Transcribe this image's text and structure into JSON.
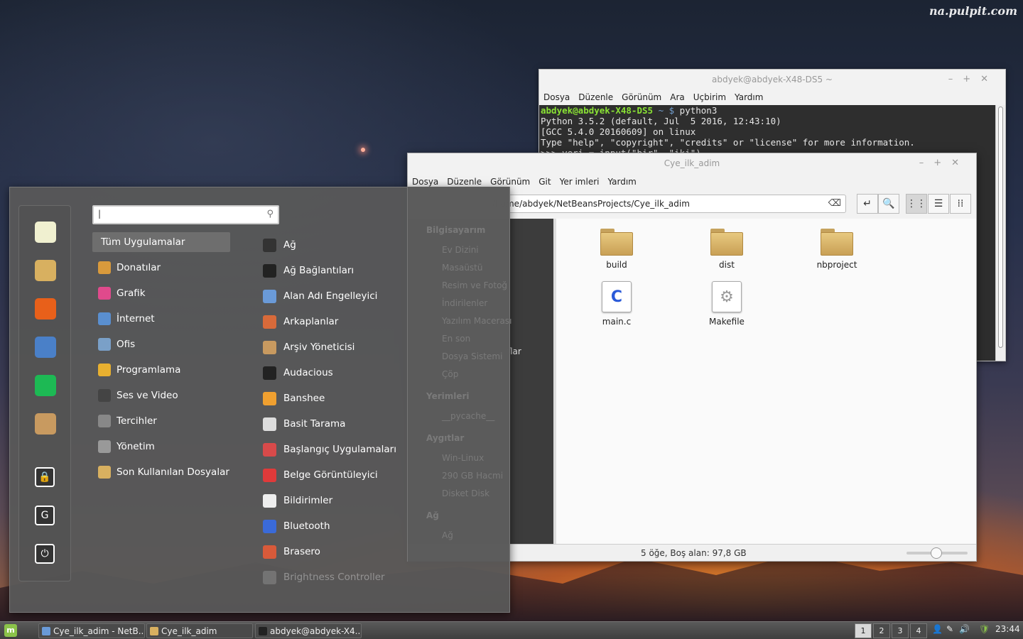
{
  "watermark": "na.pulpit.com",
  "terminal": {
    "title": "abdyek@abdyek-X48-DS5 ~",
    "menu": [
      "Dosya",
      "Düzenle",
      "Görünüm",
      "Ara",
      "Uçbirim",
      "Yardım"
    ],
    "prompt_user": "abdyek@abdyek-X48-DS5",
    "prompt_path": " ~ $",
    "command": " python3",
    "lines": [
      "Python 3.5.2 (default, Jul  5 2016, 12:43:10)",
      "[GCC 5.4.0 20160609] on linux",
      "Type \"help\", \"copyright\", \"credits\" or \"license\" for more information.",
      ">>> veri = input(\"bir\", \"iki\")"
    ]
  },
  "file_manager": {
    "title": "Cye_ilk_adim",
    "menu": [
      "Dosya",
      "Düzenle",
      "Görünüm",
      "Git",
      "Yer imleri",
      "Yardım"
    ],
    "path": "/home/abdyek/NetBeansProjects/Cye_ilk_adim",
    "partial_side_text": "flar",
    "files": [
      {
        "name": "build",
        "type": "folder"
      },
      {
        "name": "dist",
        "type": "folder"
      },
      {
        "name": "nbproject",
        "type": "folder"
      },
      {
        "name": "main.c",
        "type": "c-source"
      },
      {
        "name": "Makefile",
        "type": "makefile"
      }
    ],
    "status": "5 öğe, Boş alan: 97,8 GB",
    "zoom_level": 0.45
  },
  "sidebar_ghost": {
    "sections": [
      {
        "title": "Bilgisayarım",
        "items": [
          "Ev Dizini",
          "Masaüstü",
          "Resim ve Fotoğ",
          "İndirilenler",
          "Yazılım Macerası",
          "En son",
          "Dosya Sistemi",
          "Çöp"
        ]
      },
      {
        "title": "Yerimleri",
        "items": [
          "__pycache__"
        ]
      },
      {
        "title": "Aygıtlar",
        "items": [
          "Win-Linux",
          "290 GB Hacmi",
          "Disket Disk"
        ]
      },
      {
        "title": "Ağ",
        "items": [
          "Ağ"
        ]
      }
    ]
  },
  "start_menu": {
    "search_value": "",
    "categories": [
      {
        "label": "Tüm Uygulamalar",
        "icon": "all-apps-icon",
        "color": "#6e6e6e"
      },
      {
        "label": "Donatılar",
        "icon": "accessories-icon",
        "color": "#d99a3c"
      },
      {
        "label": "Grafik",
        "icon": "graphics-icon",
        "color": "#e04a8c"
      },
      {
        "label": "İnternet",
        "icon": "internet-icon",
        "color": "#5a8fd0"
      },
      {
        "label": "Ofis",
        "icon": "office-icon",
        "color": "#7aa0c8"
      },
      {
        "label": "Programlama",
        "icon": "programming-icon",
        "color": "#e8b030"
      },
      {
        "label": "Ses ve Video",
        "icon": "sound-video-icon",
        "color": "#444444"
      },
      {
        "label": "Tercihler",
        "icon": "preferences-icon",
        "color": "#888888"
      },
      {
        "label": "Yönetim",
        "icon": "administration-icon",
        "color": "#999999"
      },
      {
        "label": "Son Kullanılan Dosyalar",
        "icon": "recent-files-icon",
        "color": "#d8b060"
      }
    ],
    "apps": [
      {
        "label": "Ağ",
        "icon": "network-icon",
        "color": "#333333"
      },
      {
        "label": "Ağ Bağlantıları",
        "icon": "network-connections-icon",
        "color": "#222222"
      },
      {
        "label": "Alan Adı Engelleyici",
        "icon": "domain-blocker-icon",
        "color": "#6a9ad8"
      },
      {
        "label": "Arkaplanlar",
        "icon": "backgrounds-icon",
        "color": "#d86a3a"
      },
      {
        "label": "Arşiv Yöneticisi",
        "icon": "archive-manager-icon",
        "color": "#c89a60"
      },
      {
        "label": "Audacious",
        "icon": "audacious-icon",
        "color": "#222222"
      },
      {
        "label": "Banshee",
        "icon": "banshee-icon",
        "color": "#f0a030"
      },
      {
        "label": "Basit Tarama",
        "icon": "simple-scan-icon",
        "color": "#dddddd"
      },
      {
        "label": "Başlangıç Uygulamaları",
        "icon": "startup-apps-icon",
        "color": "#d84a4a"
      },
      {
        "label": "Belge Görüntüleyici",
        "icon": "document-viewer-icon",
        "color": "#e03a3a"
      },
      {
        "label": "Bildirimler",
        "icon": "notifications-icon",
        "color": "#eeeeee"
      },
      {
        "label": "Bluetooth",
        "icon": "bluetooth-icon",
        "color": "#3a6ad8"
      },
      {
        "label": "Brasero",
        "icon": "brasero-icon",
        "color": "#d85a3a"
      },
      {
        "label": "Brightness Controller",
        "icon": "brightness-icon",
        "color": "#aaaaaa"
      }
    ],
    "favorites": [
      {
        "icon": "settings-icon",
        "color": "#f0f0d0"
      },
      {
        "icon": "files-icon",
        "color": "#d8b060"
      },
      {
        "icon": "firefox-icon",
        "color": "#e8601a"
      },
      {
        "icon": "pidgin-icon",
        "color": "#4a80c8"
      },
      {
        "icon": "spotify-icon",
        "color": "#1db954"
      },
      {
        "icon": "package-icon",
        "color": "#c89a60"
      }
    ],
    "system": [
      {
        "icon": "lock-icon",
        "glyph": "🔒"
      },
      {
        "icon": "logout-icon",
        "glyph": "G"
      },
      {
        "icon": "power-icon",
        "glyph": "⏻"
      }
    ]
  },
  "taskbar": {
    "tasks": [
      {
        "label": "Cye_ilk_adim - NetB...",
        "icon": "netbeans-icon",
        "color": "#6a9ad8"
      },
      {
        "label": "Cye_ilk_adim",
        "icon": "folder-icon",
        "color": "#d8b060"
      },
      {
        "label": "abdyek@abdyek-X4...",
        "icon": "terminal-icon",
        "color": "#222222"
      }
    ],
    "workspaces": [
      "1",
      "2",
      "3",
      "4"
    ],
    "active_workspace": "1",
    "clock": "23:44"
  }
}
